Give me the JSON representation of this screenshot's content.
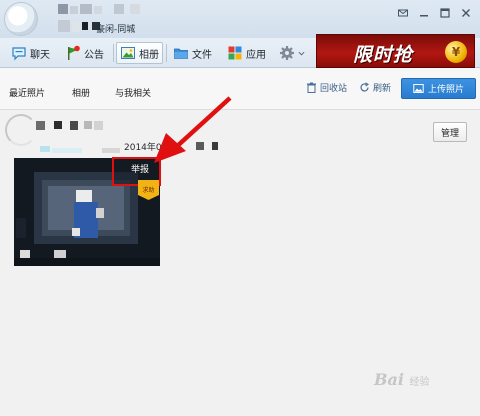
{
  "window": {
    "group_name": "豪闲-同城"
  },
  "toolbar": {
    "tabs": [
      {
        "label": "聊天",
        "icon": "chat-bubble-icon"
      },
      {
        "label": "公告",
        "icon": "announcement-flag-icon"
      },
      {
        "label": "相册",
        "icon": "photo-album-icon",
        "active": true
      },
      {
        "label": "文件",
        "icon": "folder-icon"
      },
      {
        "label": "应用",
        "icon": "apps-grid-icon"
      }
    ],
    "settings_icon": "gear-icon"
  },
  "promo": {
    "text": "限时抢",
    "coin": "¥"
  },
  "subnav": {
    "tabs": [
      "最近照片",
      "相册",
      "与我相关"
    ],
    "recycle_label": "回收站",
    "refresh_label": "刷新",
    "upload_label": "上传照片"
  },
  "content": {
    "manage_label": "管理",
    "date": "2014年09月",
    "photo": {
      "report_label": "举报",
      "badge": "求助"
    }
  },
  "watermark": {
    "brand": "Bai",
    "brand_tail": "经验"
  },
  "colors": {
    "accent": "#2a7bcf",
    "highlight": "#e01010",
    "promo": "#b21712"
  }
}
